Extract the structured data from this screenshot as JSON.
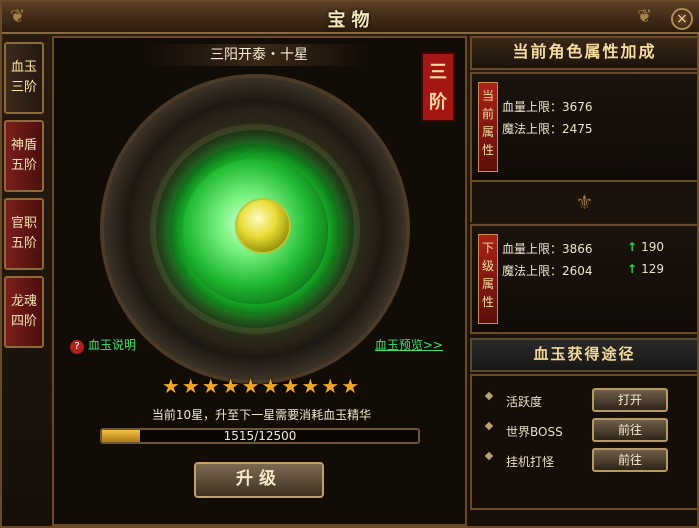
{
  "window": {
    "title": "宝物",
    "close_label": "×"
  },
  "tabs": [
    {
      "label": "血玉\n三阶"
    },
    {
      "label": "神盾\n五阶"
    },
    {
      "label": "官职\n五阶"
    },
    {
      "label": "龙魂\n四阶"
    }
  ],
  "treasure": {
    "stage_title": "三阳开泰・十星",
    "rank_seal": "三\n阶",
    "help_label": "血玉说明",
    "preview_label": "血玉预览>>",
    "stars_count": 10,
    "stars_text": "★★★★★★★★★★",
    "need_text": "当前10星，升至下一星需要消耗血玉精华",
    "progress": {
      "current": 1515,
      "max": 12500,
      "label": "1515/12500"
    },
    "upgrade_label": "升级"
  },
  "right": {
    "header": "当前角色属性加成",
    "current": {
      "tag": "当\n前\n属\n性",
      "hp_label": "血量上限：3676",
      "mp_label": "魔法上限：2475"
    },
    "next": {
      "tag": "下\n级\n属\n性",
      "hp_label": "血量上限：3866",
      "hp_inc": "190",
      "mp_label": "魔法上限：2604",
      "mp_inc": "129"
    },
    "source_header": "血玉获得途径",
    "sources": [
      {
        "label": "活跃度",
        "button": "打开"
      },
      {
        "label": "世界BOSS",
        "button": "前往"
      },
      {
        "label": "挂机打怪",
        "button": "前往"
      }
    ]
  }
}
